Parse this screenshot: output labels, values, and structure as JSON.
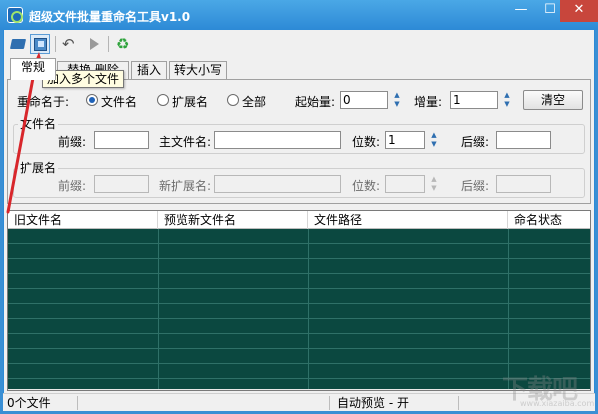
{
  "window": {
    "title": "超级文件批量重命名工具v1.0",
    "min_glyph": "—",
    "max_glyph": "☐",
    "close_glyph": "✕"
  },
  "toolbar": {
    "icons": [
      "folder-open-icon",
      "add-files-icon",
      "undo-icon",
      "play-icon",
      "recycle-icon"
    ],
    "undo_glyph": "↶",
    "recycle_glyph": "♻",
    "tooltip": "加入多个文件"
  },
  "tabs": [
    {
      "label": "常规",
      "selected": true
    },
    {
      "label": "替换 删除",
      "selected": false
    },
    {
      "label": "插入",
      "selected": false
    },
    {
      "label": "转大小写",
      "selected": false
    }
  ],
  "rename": {
    "label": "重命名于:",
    "options": [
      {
        "label": "文件名",
        "checked": true
      },
      {
        "label": "扩展名",
        "checked": false
      },
      {
        "label": "全部",
        "checked": false
      }
    ],
    "start_label": "起始量:",
    "start_value": "0",
    "step_label": "增量:",
    "step_value": "1",
    "clear_button": "清空"
  },
  "filename_group": {
    "title": "文件名",
    "prefix_label": "前缀:",
    "prefix_value": "",
    "main_label": "主文件名:",
    "main_value": "",
    "digits_label": "位数:",
    "digits_value": "1",
    "suffix_label": "后缀:",
    "suffix_value": ""
  },
  "extension_group": {
    "title": "扩展名",
    "prefix_label": "前缀:",
    "newext_label": "新扩展名:",
    "digits_label": "位数:",
    "suffix_label": "后缀:"
  },
  "list": {
    "columns": [
      "旧文件名",
      "预览新文件名",
      "文件路径",
      "命名状态"
    ],
    "rows": []
  },
  "status": {
    "count": "0个文件",
    "middle": "",
    "preview": "自动预览 - 开",
    "right": ""
  },
  "colors": {
    "titlebar": "#2d8ad6",
    "list_background": "#0b4840",
    "annotation_arrow": "#d8262b"
  },
  "watermark": {
    "text": "下载吧",
    "sub": "www.xiazaiba.com"
  }
}
